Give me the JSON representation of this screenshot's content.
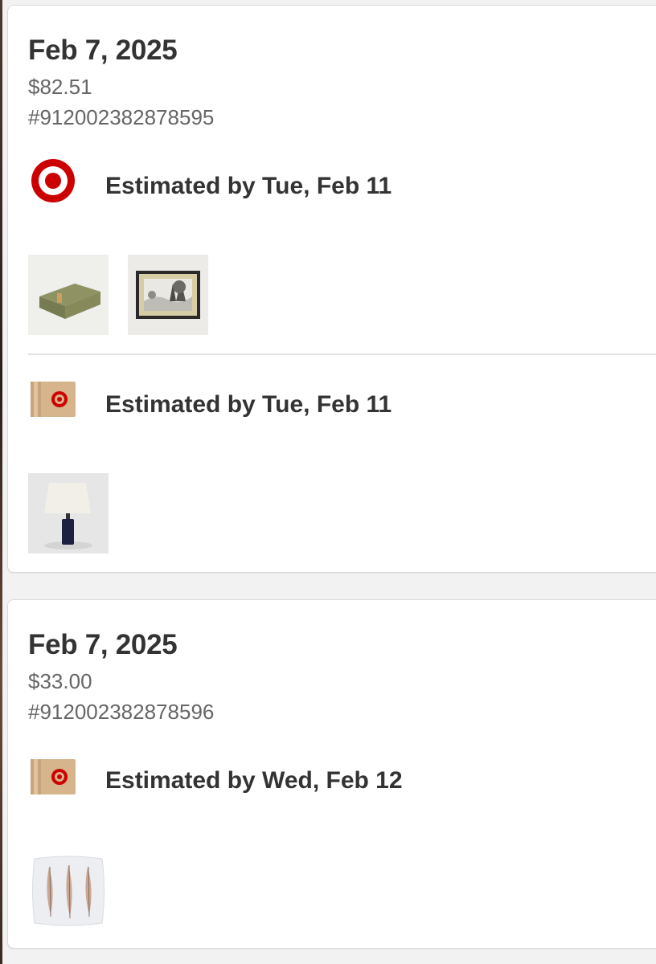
{
  "colors": {
    "target_red": "#cc0000",
    "text_primary": "#333333",
    "text_secondary": "#666666",
    "box_kraft": "#d6b48c"
  },
  "orders": [
    {
      "date": "Feb 7, 2025",
      "total": "$82.51",
      "number": "#912002382878595",
      "shipments": [
        {
          "icon": "target-bullseye-icon",
          "label": "Estimated by Tue, Feb 11",
          "items": [
            "green-storage-box",
            "framed-landscape-art"
          ]
        },
        {
          "icon": "shipping-box-icon",
          "label": "Estimated by Tue, Feb 11",
          "items": [
            "table-lamp"
          ]
        }
      ]
    },
    {
      "date": "Feb 7, 2025",
      "total": "$33.00",
      "number": "#912002382878596",
      "shipments": [
        {
          "icon": "shipping-box-icon",
          "label": "Estimated by Wed, Feb 12",
          "items": [
            "feather-throw-pillow"
          ]
        }
      ]
    }
  ]
}
